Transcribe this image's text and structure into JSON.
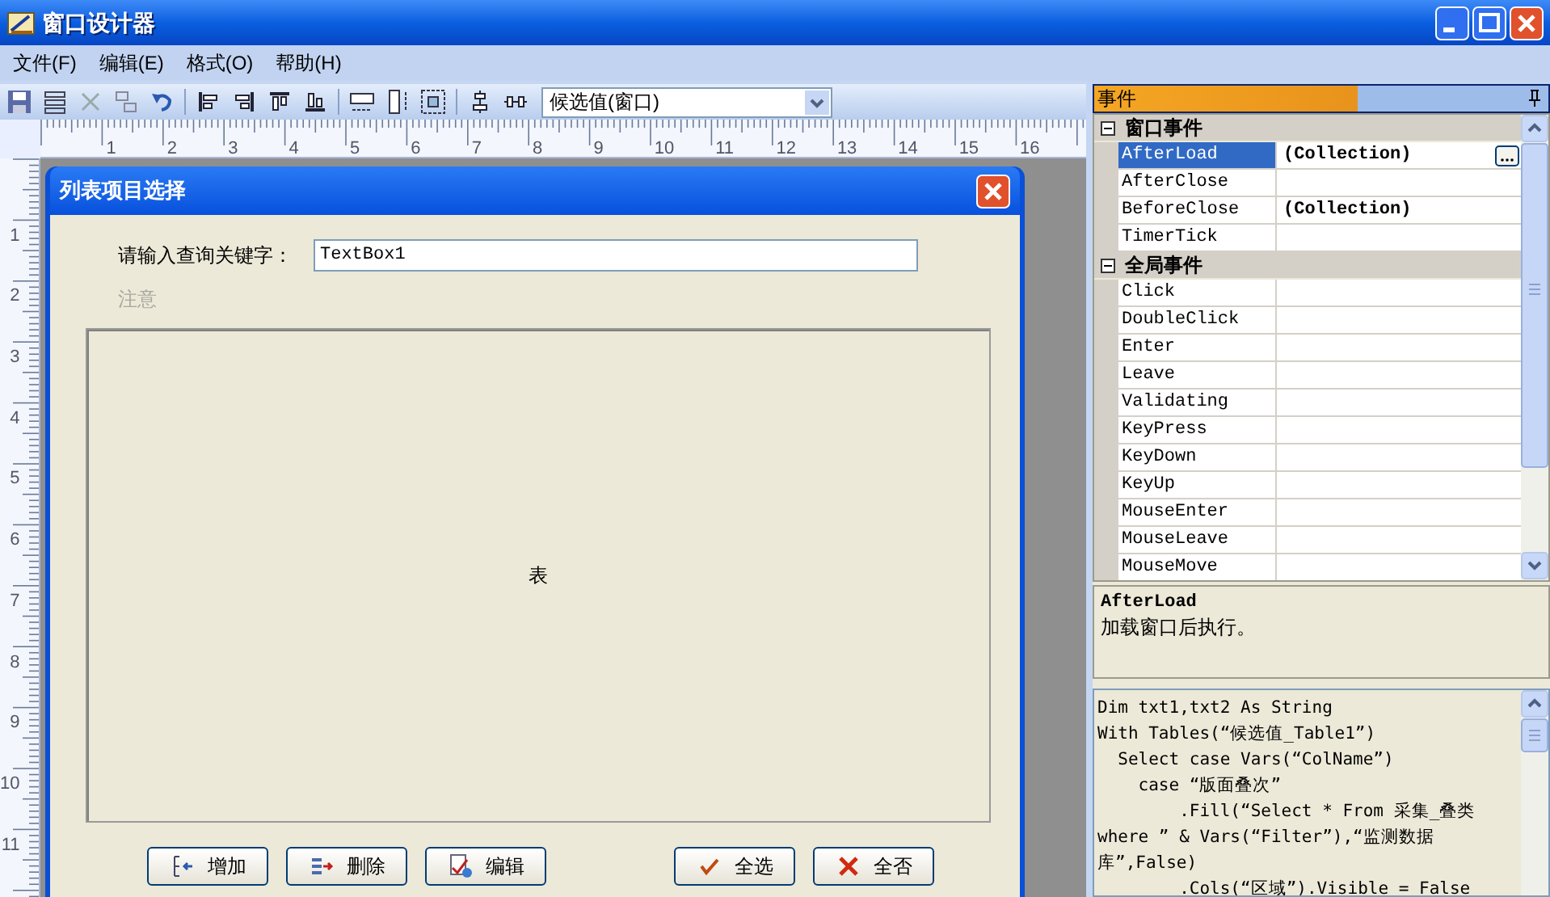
{
  "window": {
    "title": "窗口设计器"
  },
  "menu": [
    {
      "label": "文件(F)"
    },
    {
      "label": "编辑(E)"
    },
    {
      "label": "格式(O)"
    },
    {
      "label": "帮助(H)"
    }
  ],
  "toolbar": {
    "object_dropdown": "候选值(窗口)"
  },
  "ruler": {
    "horizontal": [
      "1",
      "2",
      "3",
      "4",
      "5",
      "6",
      "7",
      "8",
      "9",
      "10",
      "11",
      "12",
      "13",
      "14",
      "15",
      "16"
    ],
    "vertical": [
      "1",
      "2",
      "3",
      "4",
      "5",
      "6",
      "7",
      "8",
      "9",
      "10",
      "11"
    ]
  },
  "dialog": {
    "title": "列表项目选择",
    "search_label": "请输入查询关键字：",
    "search_value": "TextBox1",
    "note": "注意",
    "table_label": "表",
    "buttons": [
      {
        "label": "增加",
        "kind": "add"
      },
      {
        "label": "删除",
        "kind": "remove"
      },
      {
        "label": "编辑",
        "kind": "edit"
      },
      {
        "label": "全选",
        "kind": "select_all"
      },
      {
        "label": "全否",
        "kind": "select_none"
      }
    ]
  },
  "events_panel": {
    "title": "事件",
    "categories": [
      {
        "label": "窗口事件",
        "expanded": true,
        "events": [
          {
            "name": "AfterLoad",
            "value": "(Collection)",
            "selected": true,
            "button": true
          },
          {
            "name": "AfterClose",
            "selected": false,
            "button": false
          },
          {
            "name": "BeforeClose",
            "value": "(Collection)",
            "selected": false,
            "button": false
          },
          {
            "name": "TimerTick",
            "selected": false,
            "button": false
          }
        ]
      },
      {
        "label": "全局事件",
        "expanded": true,
        "events": [
          {
            "name": "Click",
            "selected": false,
            "button": false
          },
          {
            "name": "DoubleClick",
            "selected": false,
            "button": false
          },
          {
            "name": "Enter",
            "selected": false,
            "button": false
          },
          {
            "name": "Leave",
            "selected": false,
            "button": false
          },
          {
            "name": "Validating",
            "selected": false,
            "button": false
          },
          {
            "name": "KeyPress",
            "selected": false,
            "button": false
          },
          {
            "name": "KeyDown",
            "selected": false,
            "button": false
          },
          {
            "name": "KeyUp",
            "selected": false,
            "button": false
          },
          {
            "name": "MouseEnter",
            "selected": false,
            "button": false
          },
          {
            "name": "MouseLeave",
            "selected": false,
            "button": false
          },
          {
            "name": "MouseMove",
            "selected": false,
            "button": false
          }
        ]
      }
    ]
  },
  "description": {
    "title": "AfterLoad",
    "text": "加载窗口后执行。"
  },
  "code": {
    "lines": [
      "Dim txt1,txt2 As String",
      "With Tables(“候选值_Table1”)",
      "  Select case Vars(“ColName”)",
      "    case “版面叠次”",
      "        .Fill(“Select * From 采集_叠类",
      "where ” & Vars(“Filter”),“监测数据",
      "库”,False)",
      "        .Cols(“区域”).Visible = False"
    ]
  }
}
